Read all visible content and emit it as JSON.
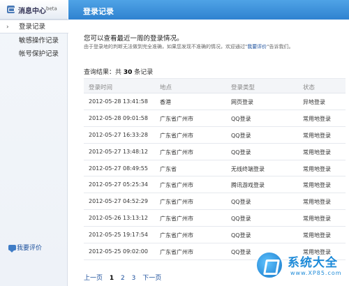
{
  "sidebar": {
    "title": "消息中心",
    "title_sup": "beta",
    "items": [
      {
        "label": "登录记录",
        "active": true
      },
      {
        "label": "敏感操作记录",
        "active": false
      },
      {
        "label": "帐号保护记录",
        "active": false
      }
    ],
    "feedback": "我要评价"
  },
  "header": {
    "title": "登录记录"
  },
  "intro": "您可以查看最近一周的登录情况。",
  "note": {
    "before": "由于登录地的判断无法做到完全准确，如果您发现不准确的情况，欢迎通过\"",
    "link": "我要评价",
    "after": "\"告诉我们。"
  },
  "result": {
    "prefix": "查询结果：共",
    "count": "30",
    "suffix": "条记录"
  },
  "table": {
    "columns": [
      "登录时间",
      "地点",
      "登录类型",
      "状态"
    ],
    "rows": [
      [
        "2012-05-28 13:41:58",
        "香港",
        "网页登录",
        "异地登录"
      ],
      [
        "2012-05-28 09:01:58",
        "广东省广州市",
        "QQ登录",
        "常用地登录"
      ],
      [
        "2012-05-27 16:33:28",
        "广东省广州市",
        "QQ登录",
        "常用地登录"
      ],
      [
        "2012-05-27 13:48:12",
        "广东省广州市",
        "QQ登录",
        "常用地登录"
      ],
      [
        "2012-05-27 08:49:55",
        "广东省",
        "无线终端登录",
        "常用地登录"
      ],
      [
        "2012-05-27 05:25:34",
        "广东省广州市",
        "腾讯游戏登录",
        "常用地登录"
      ],
      [
        "2012-05-27 04:52:29",
        "广东省广州市",
        "QQ登录",
        "常用地登录"
      ],
      [
        "2012-05-26 13:13:12",
        "广东省广州市",
        "QQ登录",
        "常用地登录"
      ],
      [
        "2012-05-25 19:17:54",
        "广东省广州市",
        "QQ登录",
        "常用地登录"
      ],
      [
        "2012-05-25 09:02:00",
        "广东省广州市",
        "QQ登录",
        "常用地登录"
      ]
    ]
  },
  "pager": {
    "prev": "上一页",
    "pages": [
      "1",
      "2",
      "3"
    ],
    "current": "1",
    "next": "下一页"
  },
  "watermark": {
    "title": "系统大全",
    "url": "www.XP85.com"
  }
}
